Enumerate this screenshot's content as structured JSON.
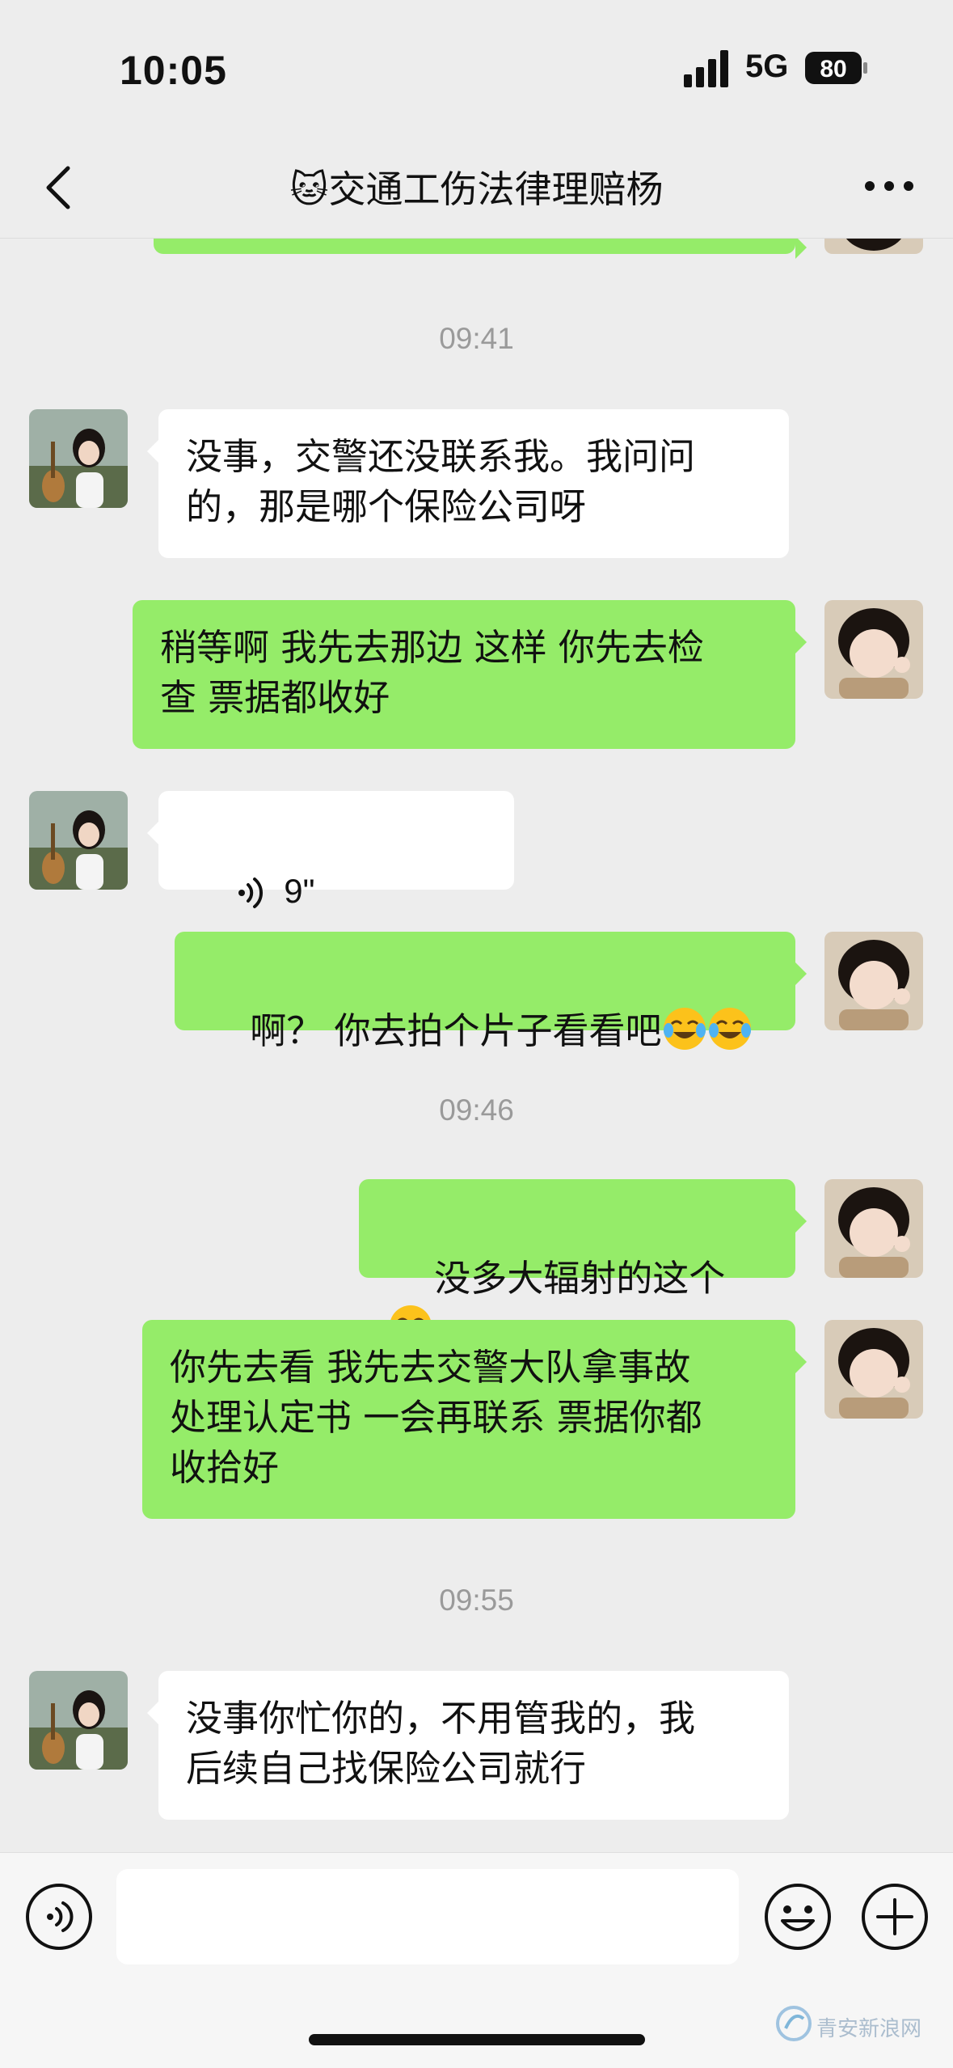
{
  "status_bar": {
    "time": "10:05",
    "network": "5G",
    "battery": "80"
  },
  "header": {
    "title": "🐱交通工伤法律理赔杨",
    "back_icon": "chevron-left-icon",
    "more_icon": "more-icon"
  },
  "messages": [
    {
      "type": "timestamp",
      "text": "09:41"
    },
    {
      "type": "text",
      "side": "in",
      "text": "没事，交警还没联系我。我问问\n的，那是哪个保险公司呀"
    },
    {
      "type": "text",
      "side": "out",
      "text": "稍等啊 我先去那边 这样 你先去检\n查 票据都收好"
    },
    {
      "type": "voice",
      "side": "in",
      "duration": "9\""
    },
    {
      "type": "text",
      "side": "out",
      "text": "啊？ 你去拍个片子看看吧",
      "emoji": [
        "face-with-tears-of-joy",
        "face-with-tears-of-joy"
      ]
    },
    {
      "type": "timestamp",
      "text": "09:46"
    },
    {
      "type": "text",
      "side": "out",
      "text": "没多大辐射的这个",
      "emoji": [
        "face-with-tears-of-joy"
      ]
    },
    {
      "type": "text",
      "side": "out",
      "text": "你先去看 我先去交警大队拿事故\n处理认定书 一会再联系 票据你都\n收拾好"
    },
    {
      "type": "timestamp",
      "text": "09:55"
    },
    {
      "type": "text",
      "side": "in",
      "text": "没事你忙你的，不用管我的，我\n后续自己找保险公司就行"
    }
  ],
  "input_bar": {
    "voice_icon": "voice-icon",
    "emoji_icon": "emoji-icon",
    "plus_icon": "plus-icon",
    "value": ""
  },
  "watermark": "青安新浪网",
  "colors": {
    "background": "#ededed",
    "outgoing_bubble": "#95ec69",
    "incoming_bubble": "#ffffff",
    "timestamp": "#9a9a9a"
  }
}
